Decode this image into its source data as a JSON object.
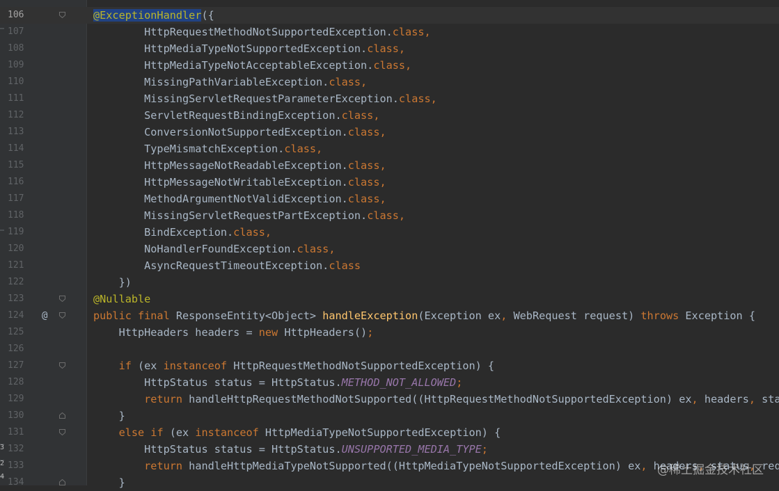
{
  "editor": {
    "lines": [
      {
        "n": "106",
        "current": true,
        "fold": "start",
        "tokens": [
          {
            "c": "ann-hl",
            "t": "@ExceptionHandler"
          },
          {
            "c": "plain",
            "t": "({"
          }
        ]
      },
      {
        "n": "107",
        "tokens": [
          {
            "c": "plain",
            "t": "        HttpRequestMethodNotSupportedException."
          },
          {
            "c": "kw",
            "t": "class,"
          }
        ]
      },
      {
        "n": "108",
        "tokens": [
          {
            "c": "plain",
            "t": "        HttpMediaTypeNotSupportedException."
          },
          {
            "c": "kw",
            "t": "class,"
          }
        ]
      },
      {
        "n": "109",
        "tokens": [
          {
            "c": "plain",
            "t": "        HttpMediaTypeNotAcceptableException."
          },
          {
            "c": "kw",
            "t": "class,"
          }
        ]
      },
      {
        "n": "110",
        "tokens": [
          {
            "c": "plain",
            "t": "        MissingPathVariableException."
          },
          {
            "c": "kw",
            "t": "class,"
          }
        ]
      },
      {
        "n": "111",
        "tokens": [
          {
            "c": "plain",
            "t": "        MissingServletRequestParameterException."
          },
          {
            "c": "kw",
            "t": "class,"
          }
        ]
      },
      {
        "n": "112",
        "tokens": [
          {
            "c": "plain",
            "t": "        ServletRequestBindingException."
          },
          {
            "c": "kw",
            "t": "class,"
          }
        ]
      },
      {
        "n": "113",
        "tokens": [
          {
            "c": "plain",
            "t": "        ConversionNotSupportedException."
          },
          {
            "c": "kw",
            "t": "class,"
          }
        ]
      },
      {
        "n": "114",
        "tokens": [
          {
            "c": "plain",
            "t": "        TypeMismatchException."
          },
          {
            "c": "kw",
            "t": "class,"
          }
        ]
      },
      {
        "n": "115",
        "tokens": [
          {
            "c": "plain",
            "t": "        HttpMessageNotReadableException."
          },
          {
            "c": "kw",
            "t": "class,"
          }
        ]
      },
      {
        "n": "116",
        "tokens": [
          {
            "c": "plain",
            "t": "        HttpMessageNotWritableException."
          },
          {
            "c": "kw",
            "t": "class,"
          }
        ]
      },
      {
        "n": "117",
        "tokens": [
          {
            "c": "plain",
            "t": "        MethodArgumentNotValidException."
          },
          {
            "c": "kw",
            "t": "class,"
          }
        ]
      },
      {
        "n": "118",
        "tokens": [
          {
            "c": "plain",
            "t": "        MissingServletRequestPartException."
          },
          {
            "c": "kw",
            "t": "class,"
          }
        ]
      },
      {
        "n": "119",
        "tokens": [
          {
            "c": "plain",
            "t": "        BindException."
          },
          {
            "c": "kw",
            "t": "class,"
          }
        ]
      },
      {
        "n": "120",
        "tokens": [
          {
            "c": "plain",
            "t": "        NoHandlerFoundException."
          },
          {
            "c": "kw",
            "t": "class,"
          }
        ]
      },
      {
        "n": "121",
        "tokens": [
          {
            "c": "plain",
            "t": "        AsyncRequestTimeoutException."
          },
          {
            "c": "kw",
            "t": "class"
          }
        ]
      },
      {
        "n": "122",
        "tokens": [
          {
            "c": "plain",
            "t": "    })"
          }
        ]
      },
      {
        "n": "123",
        "fold": "start",
        "tokens": [
          {
            "c": "ann",
            "t": "@Nullable"
          }
        ]
      },
      {
        "n": "124",
        "fold": "start",
        "at": "@",
        "tokens": [
          {
            "c": "kw",
            "t": "public final "
          },
          {
            "c": "plain",
            "t": "ResponseEntity<Object> "
          },
          {
            "c": "fn",
            "t": "handleException"
          },
          {
            "c": "plain",
            "t": "(Exception ex"
          },
          {
            "c": "kw",
            "t": ", "
          },
          {
            "c": "plain",
            "t": "WebRequest request) "
          },
          {
            "c": "kw",
            "t": "throws "
          },
          {
            "c": "plain",
            "t": "Exception {"
          }
        ]
      },
      {
        "n": "125",
        "tokens": [
          {
            "c": "plain",
            "t": "    HttpHeaders headers = "
          },
          {
            "c": "kw",
            "t": "new "
          },
          {
            "c": "plain",
            "t": "HttpHeaders()"
          },
          {
            "c": "kw",
            "t": ";"
          }
        ]
      },
      {
        "n": "126",
        "tokens": []
      },
      {
        "n": "127",
        "fold": "start",
        "tokens": [
          {
            "c": "plain",
            "t": "    "
          },
          {
            "c": "kw",
            "t": "if "
          },
          {
            "c": "plain",
            "t": "(ex "
          },
          {
            "c": "kw",
            "t": "instanceof "
          },
          {
            "c": "plain",
            "t": "HttpRequestMethodNotSupportedException) {"
          }
        ]
      },
      {
        "n": "128",
        "tokens": [
          {
            "c": "plain",
            "t": "        HttpStatus status = HttpStatus."
          },
          {
            "c": "konst",
            "t": "METHOD_NOT_ALLOWED"
          },
          {
            "c": "kw",
            "t": ";"
          }
        ]
      },
      {
        "n": "129",
        "tokens": [
          {
            "c": "plain",
            "t": "        "
          },
          {
            "c": "kw",
            "t": "return "
          },
          {
            "c": "plain",
            "t": "handleHttpRequestMethodNotSupported((HttpRequestMethodNotSupportedException) ex"
          },
          {
            "c": "kw",
            "t": ", "
          },
          {
            "c": "plain",
            "t": "headers"
          },
          {
            "c": "kw",
            "t": ", "
          },
          {
            "c": "plain",
            "t": "status"
          }
        ]
      },
      {
        "n": "130",
        "fold": "end",
        "tokens": [
          {
            "c": "plain",
            "t": "    }"
          }
        ]
      },
      {
        "n": "131",
        "fold": "start",
        "tokens": [
          {
            "c": "plain",
            "t": "    "
          },
          {
            "c": "kw",
            "t": "else if "
          },
          {
            "c": "plain",
            "t": "(ex "
          },
          {
            "c": "kw",
            "t": "instanceof "
          },
          {
            "c": "plain",
            "t": "HttpMediaTypeNotSupportedException) {"
          }
        ]
      },
      {
        "n": "132",
        "tokens": [
          {
            "c": "plain",
            "t": "        HttpStatus status = HttpStatus."
          },
          {
            "c": "konst",
            "t": "UNSUPPORTED_MEDIA_TYPE"
          },
          {
            "c": "kw",
            "t": ";"
          }
        ]
      },
      {
        "n": "133",
        "tokens": [
          {
            "c": "plain",
            "t": "        "
          },
          {
            "c": "kw",
            "t": "return "
          },
          {
            "c": "plain",
            "t": "handleHttpMediaTypeNotSupported((HttpMediaTypeNotSupportedException) ex"
          },
          {
            "c": "kw",
            "t": ", "
          },
          {
            "c": "plain",
            "t": "headers"
          },
          {
            "c": "kw",
            "t": ", "
          },
          {
            "c": "plain",
            "t": "status"
          },
          {
            "c": "kw",
            "t": ", "
          },
          {
            "c": "plain",
            "t": "reque"
          }
        ]
      },
      {
        "n": "134",
        "fold": "end",
        "tokens": [
          {
            "c": "plain",
            "t": "    }"
          }
        ]
      }
    ]
  },
  "watermark": "@稀土掘金技术社区",
  "left_stubs": [
    "3",
    "2",
    "4"
  ]
}
